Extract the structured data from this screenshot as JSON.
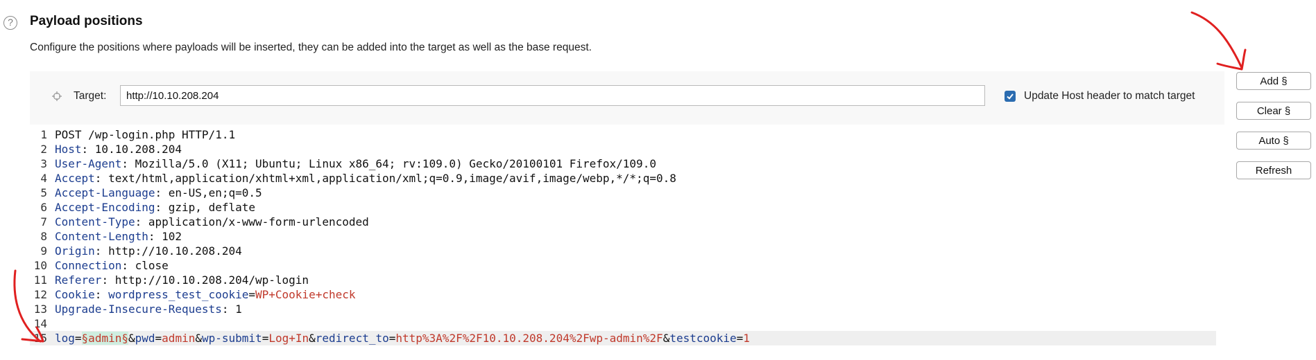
{
  "section": {
    "title": "Payload positions",
    "description": "Configure the positions where payloads will be inserted, they can be added into the target as well as the base request."
  },
  "target": {
    "label": "Target:",
    "value": "http://10.10.208.204"
  },
  "host_header": {
    "label": "Update Host header to match target",
    "checked": true
  },
  "buttons": {
    "add": "Add §",
    "clear": "Clear §",
    "auto": "Auto §",
    "refresh": "Refresh"
  },
  "request": {
    "lines": [
      {
        "no": "1",
        "text": "POST /wp-login.php HTTP/1.1"
      },
      {
        "no": "2",
        "name": "Host",
        "value": "10.10.208.204"
      },
      {
        "no": "3",
        "name": "User-Agent",
        "value": "Mozilla/5.0 (X11; Ubuntu; Linux x86_64; rv:109.0) Gecko/20100101 Firefox/109.0"
      },
      {
        "no": "4",
        "name": "Accept",
        "value": "text/html,application/xhtml+xml,application/xml;q=0.9,image/avif,image/webp,*/*;q=0.8"
      },
      {
        "no": "5",
        "name": "Accept-Language",
        "value": "en-US,en;q=0.5"
      },
      {
        "no": "6",
        "name": "Accept-Encoding",
        "value": "gzip, deflate"
      },
      {
        "no": "7",
        "name": "Content-Type",
        "value": "application/x-www-form-urlencoded"
      },
      {
        "no": "8",
        "name": "Content-Length",
        "value": "102"
      },
      {
        "no": "9",
        "name": "Origin",
        "value": "http://10.10.208.204"
      },
      {
        "no": "10",
        "name": "Connection",
        "value": "close"
      },
      {
        "no": "11",
        "name": "Referer",
        "value": "http://10.10.208.204/wp-login"
      },
      {
        "no": "12",
        "name": "Cookie",
        "cookie_name": "wordpress_test_cookie",
        "cookie_value": "WP+Cookie+check"
      },
      {
        "no": "13",
        "name": "Upgrade-Insecure-Requests",
        "value": "1"
      },
      {
        "no": "14",
        "text": ""
      }
    ],
    "body_line": {
      "no": "15",
      "params": [
        {
          "name": "log",
          "payload": "§admin§"
        },
        {
          "name": "pwd",
          "value": "admin"
        },
        {
          "name": "wp-submit",
          "value": "Log+In"
        },
        {
          "name": "redirect_to",
          "value": "http%3A%2F%2F10.10.208.204%2Fwp-admin%2F"
        },
        {
          "name": "testcookie",
          "value": "1"
        }
      ]
    }
  },
  "colors": {
    "header_name": "#1c3d8f",
    "param_value": "#c0392b",
    "payload_highlight": "#cfeee0",
    "annotation": "#e02020",
    "checkbox": "#2b6cb0"
  }
}
